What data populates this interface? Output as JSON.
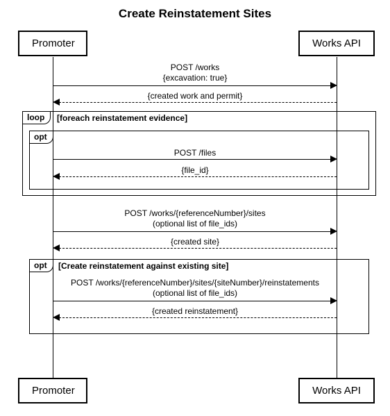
{
  "title": "Create Reinstatement Sites",
  "participants": {
    "promoter": "Promoter",
    "worksapi": "Works API"
  },
  "fragments": {
    "loop_tag": "loop",
    "loop_guard": "[foreach reinstatement evidence]",
    "opt1_tag": "opt",
    "opt2_tag": "opt",
    "opt2_guard": "[Create reinstatement against existing site]"
  },
  "messages": {
    "m1_line1": "POST /works",
    "m1_line2": "{excavation: true}",
    "r1": "{created work and permit}",
    "m2": "POST /files",
    "r2": "{file_id}",
    "m3_line1": "POST /works/{referenceNumber}/sites",
    "m3_line2": "(optional list of file_ids)",
    "r3": "{created site}",
    "m4_line1": "POST /works/{referenceNumber}/sites/{siteNumber}/reinstatements",
    "m4_line2": "(optional list of file_ids)",
    "r4": "{created reinstatement}"
  }
}
